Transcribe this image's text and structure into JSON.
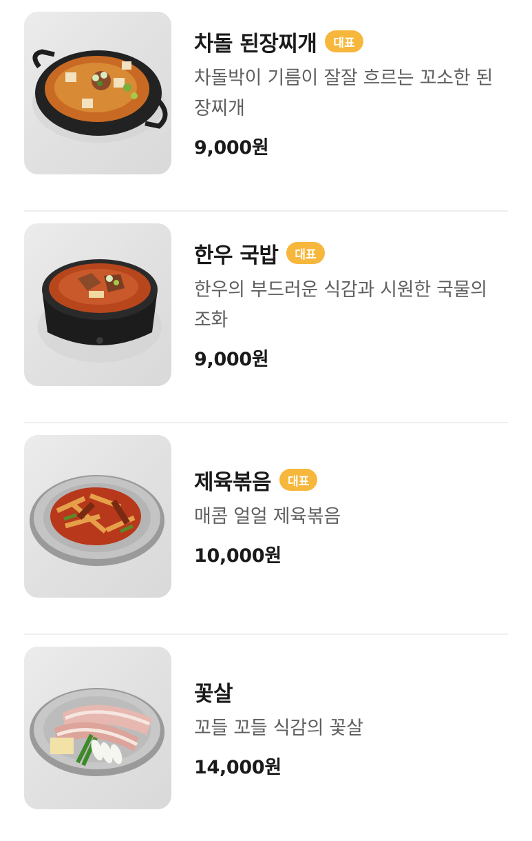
{
  "menu": {
    "badge_label": "대표",
    "items": [
      {
        "name": "차돌 된장찌개",
        "badge": "대표",
        "description": "차돌박이 기름이 잘잘 흐르는 꼬소한 된장찌개",
        "price": "9,000원",
        "image": "doenjang-jjigae-image"
      },
      {
        "name": "한우 국밥",
        "badge": "대표",
        "description": "한우의 부드러운 식감과 시원한 국물의 조화",
        "price": "9,000원",
        "image": "gukbap-image"
      },
      {
        "name": "제육볶음",
        "badge": "대표",
        "description": "매콤 얼얼 제육볶음",
        "price": "10,000원",
        "image": "jeyuk-bokkeum-image"
      },
      {
        "name": "꽃살",
        "badge": "",
        "description": "꼬들 꼬들 식감의 꽃살",
        "price": "14,000원",
        "image": "kkotsal-image"
      }
    ]
  },
  "colors": {
    "badge_bg": "#f6b73c",
    "title_text": "#1a1a1a",
    "description_text": "#5f5f5f",
    "divider": "#eeeeee"
  }
}
